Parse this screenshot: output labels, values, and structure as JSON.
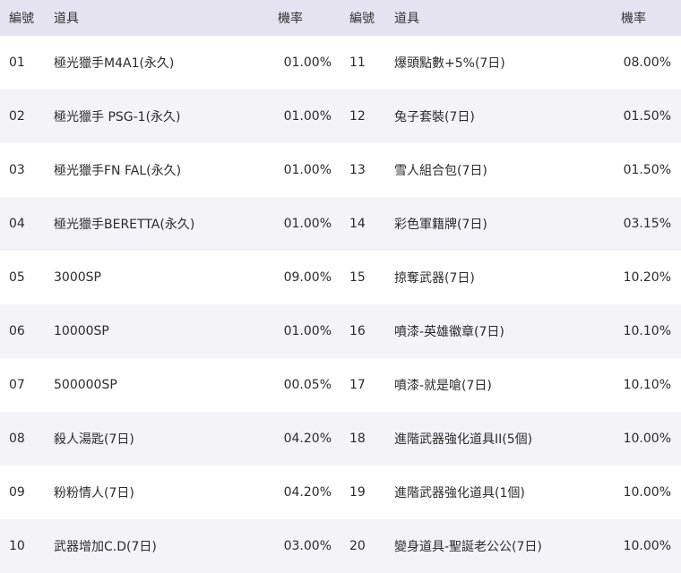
{
  "header": {
    "no": "編號",
    "item": "道具",
    "rate": "機率"
  },
  "rows": [
    {
      "left": {
        "no": "01",
        "item": "極光獵手M4A1(永久)",
        "rate": "01.00%"
      },
      "right": {
        "no": "11",
        "item": "爆頭點數+5%(7日)",
        "rate": "08.00%"
      }
    },
    {
      "left": {
        "no": "02",
        "item": "極光獵手 PSG-1(永久)",
        "rate": "01.00%"
      },
      "right": {
        "no": "12",
        "item": "兔子套裝(7日)",
        "rate": "01.50%"
      }
    },
    {
      "left": {
        "no": "03",
        "item": "極光獵手FN FAL(永久)",
        "rate": "01.00%"
      },
      "right": {
        "no": "13",
        "item": "雪人組合包(7日)",
        "rate": "01.50%"
      }
    },
    {
      "left": {
        "no": "04",
        "item": "極光獵手BERETTA(永久)",
        "rate": "01.00%"
      },
      "right": {
        "no": "14",
        "item": "彩色軍籍牌(7日)",
        "rate": "03.15%"
      }
    },
    {
      "left": {
        "no": "05",
        "item": "3000SP",
        "rate": "09.00%"
      },
      "right": {
        "no": "15",
        "item": "掠奪武器(7日)",
        "rate": "10.20%"
      }
    },
    {
      "left": {
        "no": "06",
        "item": "10000SP",
        "rate": "01.00%"
      },
      "right": {
        "no": "16",
        "item": "噴漆-英雄徽章(7日)",
        "rate": "10.10%"
      }
    },
    {
      "left": {
        "no": "07",
        "item": "500000SP",
        "rate": "00.05%"
      },
      "right": {
        "no": "17",
        "item": "噴漆-就是嗆(7日)",
        "rate": "10.10%"
      }
    },
    {
      "left": {
        "no": "08",
        "item": "殺人湯匙(7日)",
        "rate": "04.20%"
      },
      "right": {
        "no": "18",
        "item": "進階武器強化道具II(5個)",
        "rate": "10.00%"
      }
    },
    {
      "left": {
        "no": "09",
        "item": "粉粉情人(7日)",
        "rate": "04.20%"
      },
      "right": {
        "no": "19",
        "item": "進階武器強化道具(1個)",
        "rate": "10.00%"
      }
    },
    {
      "left": {
        "no": "10",
        "item": "武器增加C.D(7日)",
        "rate": "03.00%"
      },
      "right": {
        "no": "20",
        "item": "變身道具-聖誕老公公(7日)",
        "rate": "10.00%"
      }
    }
  ]
}
